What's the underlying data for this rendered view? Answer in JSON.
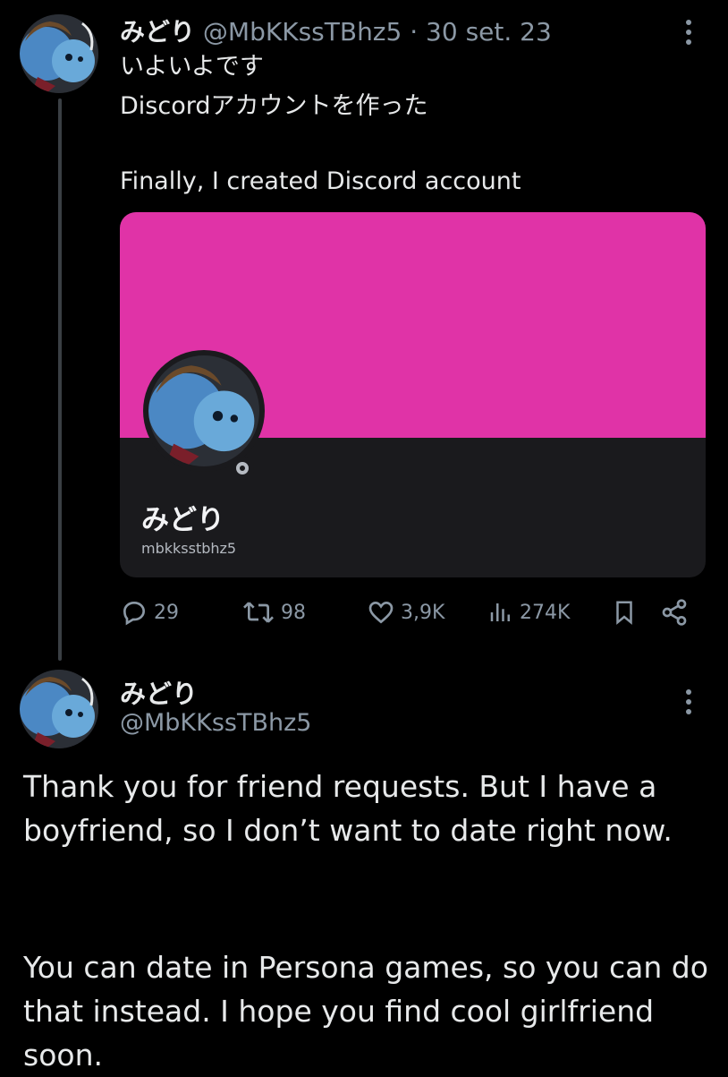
{
  "tweet1": {
    "display_name": "みどり",
    "handle": "@MbKKssTBhz5",
    "separator": "·",
    "date": "30 set. 23",
    "text_lines": [
      "いよいよです",
      "Discordアカウントを作った",
      "Finally, I created Discord account"
    ],
    "card": {
      "banner_color": "#e033a7",
      "profile_name": "みどり",
      "username": "mbkksstbhz5"
    },
    "actions": {
      "replies": "29",
      "retweets": "98",
      "likes": "3,9K",
      "views": "274K"
    }
  },
  "tweet2": {
    "display_name": "みどり",
    "handle": "@MbKKssTBhz5",
    "paragraphs": [
      "Thank you for friend requests. But I have a boyfriend, so I don’t want to date right now.",
      "You can date in Persona games, so you can do that instead. I hope you find cool girlfriend soon."
    ]
  },
  "icons": [
    "avatar-image",
    "more-icon",
    "reply-icon",
    "retweet-icon",
    "like-icon",
    "views-icon",
    "bookmark-icon",
    "share-icon",
    "status-icon"
  ],
  "colors": {
    "background": "#000000",
    "text": "#e7e9ea",
    "muted": "#8b98a5",
    "banner": "#e033a7",
    "card": "#1a1a1d"
  }
}
